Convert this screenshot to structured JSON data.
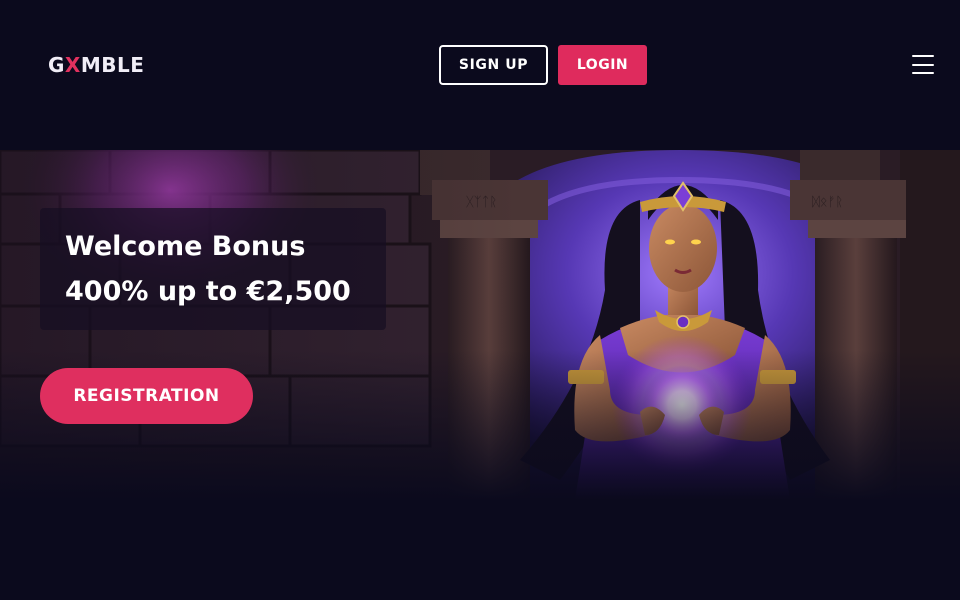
{
  "header": {
    "logo_prefix": "G",
    "logo_x": "X",
    "logo_suffix": "MBLE",
    "signup_label": "SIGN UP",
    "login_label": "LOGIN",
    "menu_icon": "hamburger-menu-icon"
  },
  "hero": {
    "bonus_title": "Welcome Bonus",
    "bonus_amount": "400% up to €2,500",
    "registration_label": "REGISTRATION",
    "image": "sorceress-with-crystal-orb"
  },
  "colors": {
    "background": "#0b0a1d",
    "accent": "#df2b5d",
    "purple_glow": "#a35cff"
  }
}
